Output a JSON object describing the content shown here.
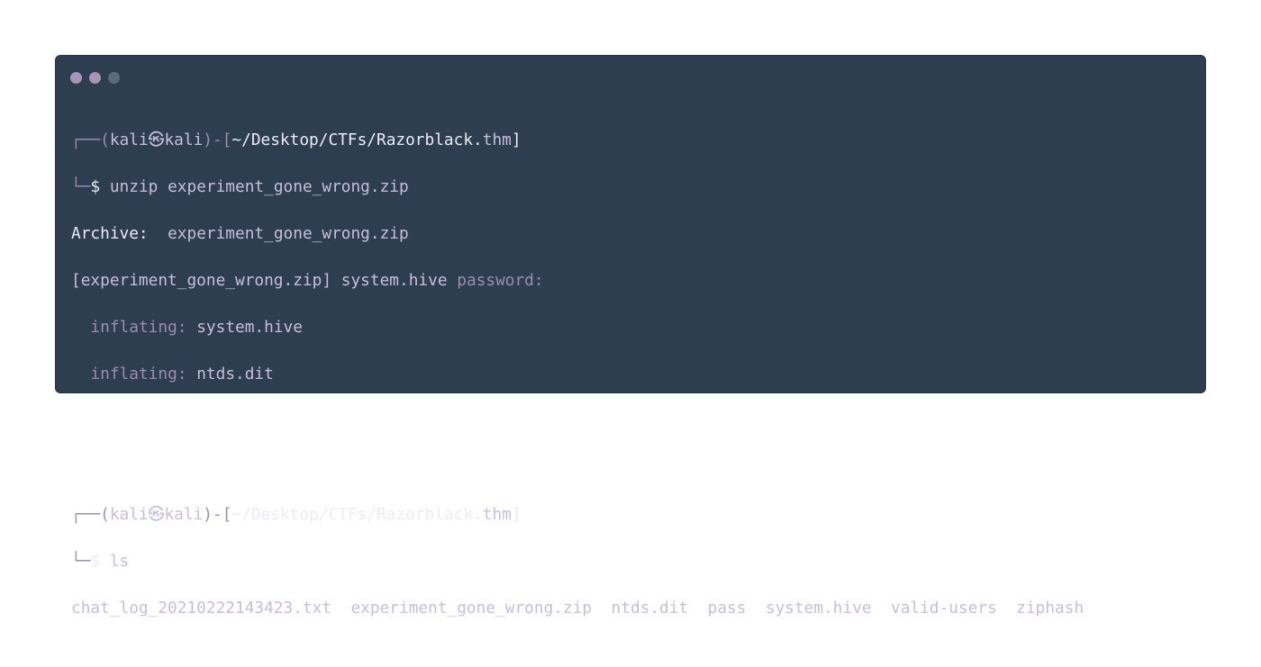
{
  "window": {
    "controls": [
      {
        "name": "close",
        "color": "#a794b7"
      },
      {
        "name": "minimize",
        "color": "#a794b7"
      },
      {
        "name": "maximize",
        "color": "#5d6a7e"
      }
    ]
  },
  "prompt1": {
    "user": "kali",
    "symbol": "㉿",
    "host": "kali",
    "path_prefix": "~/Desktop/CTFs/Razorblack.",
    "path_ext": "thm",
    "command": "unzip experiment_gone_wrong.zip"
  },
  "output1": {
    "archive_label": "Archive:",
    "archive_file": "experiment_gone_wrong.zip",
    "pw_prefix": "[experiment_gone_wrong.zip]",
    "pw_file": "system.hive",
    "pw_label": "password:",
    "inflating": [
      {
        "label": "inflating:",
        "file": "system.hive"
      },
      {
        "label": "inflating:",
        "file": "ntds.dit"
      }
    ]
  },
  "prompt2": {
    "user": "kali",
    "symbol": "㉿",
    "host": "kali",
    "path_prefix": "~/Desktop/CTFs/Razorblack.",
    "path_ext": "thm",
    "command": "ls"
  },
  "ls_output": [
    "chat_log_20210222143423.txt",
    "experiment_gone_wrong.zip",
    "ntds.dit",
    "pass",
    "system.hive",
    "valid-users",
    "ziphash"
  ]
}
